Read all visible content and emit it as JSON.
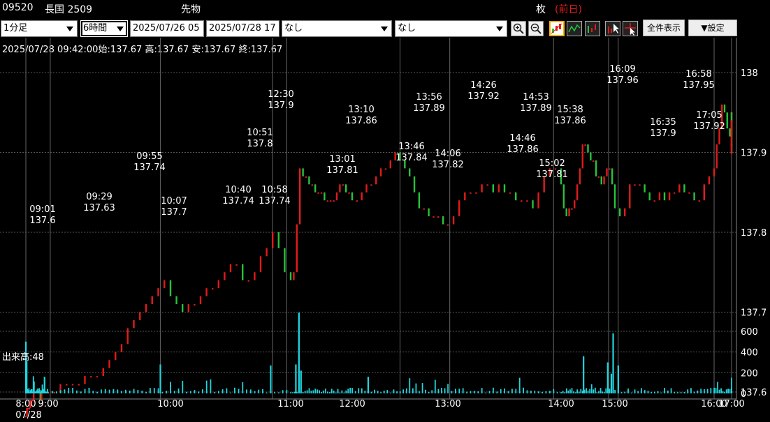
{
  "header": {
    "code": "09520",
    "name": "長国 2509",
    "category": "先物",
    "unit_label": "枚",
    "prev_label": "(前日)"
  },
  "toolbar": {
    "interval": "1分足",
    "period": "6時間",
    "date_from": "2025/07/26 05",
    "date_to": "2025/07/28 17",
    "indicator1": "なし",
    "indicator2": "なし",
    "zoom_in_icon": "zoom-in-icon",
    "zoom_out_icon": "zoom-out-icon",
    "full_view_label": "全件表示",
    "settings_label": "▼設定"
  },
  "info_line": "2025/07/28 09:42:00始:137.67 高:137.67 安:137.67 終:137.67",
  "volume_label": "出来高:48",
  "date_label": "07/28",
  "colors": {
    "up": "#e21b1b",
    "down": "#27c33c",
    "volume": "#1fd6e0",
    "grid": "#555555",
    "accent": "#e21b1b"
  },
  "chart_data": [
    {
      "type": "candlestick",
      "x_ticks": [
        "8:00",
        "9:00",
        "10:00",
        "11:00",
        "12:00",
        "13:00",
        "14:00",
        "15:00",
        "16:00",
        "17:00"
      ],
      "y_ticks": [
        137.6,
        137.7,
        137.8,
        137.9,
        138
      ],
      "ylim": [
        137.52,
        138.02
      ],
      "price_path": [
        [
          "8:00",
          137.57
        ],
        [
          "8:05",
          137.58
        ],
        [
          "8:15",
          137.59
        ],
        [
          "8:30",
          137.6
        ],
        [
          "9:01",
          137.6
        ],
        [
          "9:10",
          137.61
        ],
        [
          "9:20",
          137.62
        ],
        [
          "9:29",
          137.63
        ],
        [
          "9:40",
          137.68
        ],
        [
          "9:48",
          137.71
        ],
        [
          "9:55",
          137.74
        ],
        [
          "10:02",
          137.72
        ],
        [
          "10:07",
          137.7
        ],
        [
          "10:20",
          137.73
        ],
        [
          "10:30",
          137.76
        ],
        [
          "10:40",
          137.74
        ],
        [
          "10:45",
          137.77
        ],
        [
          "10:51",
          137.8
        ],
        [
          "10:55",
          137.77
        ],
        [
          "10:58",
          137.74
        ],
        [
          "11:00",
          137.73
        ],
        [
          "11:05",
          137.76
        ],
        [
          "11:08",
          137.9
        ],
        [
          "11:10",
          137.87
        ],
        [
          "11:30",
          137.85
        ],
        [
          "11:40",
          137.83
        ],
        [
          "11:50",
          137.86
        ],
        [
          "12:00",
          137.84
        ],
        [
          "12:30",
          137.9
        ],
        [
          "12:45",
          137.82
        ],
        [
          "13:01",
          137.81
        ],
        [
          "13:10",
          137.86
        ],
        [
          "13:30",
          137.85
        ],
        [
          "13:46",
          137.84
        ],
        [
          "13:56",
          137.89
        ],
        [
          "14:00",
          137.86
        ],
        [
          "14:06",
          137.82
        ],
        [
          "14:15",
          137.84
        ],
        [
          "14:26",
          137.92
        ],
        [
          "14:40",
          137.87
        ],
        [
          "14:46",
          137.86
        ],
        [
          "14:53",
          137.89
        ],
        [
          "15:02",
          137.81
        ],
        [
          "15:10",
          137.86
        ],
        [
          "15:25",
          137.84
        ],
        [
          "15:38",
          137.86
        ],
        [
          "15:50",
          137.84
        ],
        [
          "16:00",
          137.88
        ],
        [
          "16:09",
          137.96
        ],
        [
          "16:20",
          137.91
        ],
        [
          "16:35",
          137.9
        ],
        [
          "16:45",
          137.94
        ],
        [
          "16:58",
          137.95
        ],
        [
          "17:05",
          137.92
        ],
        [
          "17:15",
          137.94
        ]
      ],
      "annotations": [
        {
          "time": "09:01",
          "price": "137.6"
        },
        {
          "time": "09:29",
          "price": "137.63"
        },
        {
          "time": "09:55",
          "price": "137.74"
        },
        {
          "time": "10:07",
          "price": "137.7"
        },
        {
          "time": "10:40",
          "price": "137.74"
        },
        {
          "time": "10:51",
          "price": "137.8"
        },
        {
          "time": "10:58",
          "price": "137.74"
        },
        {
          "time": "12:30",
          "price": "137.9"
        },
        {
          "time": "13:01",
          "price": "137.81"
        },
        {
          "time": "13:10",
          "price": "137.86"
        },
        {
          "time": "13:46",
          "price": "137.84"
        },
        {
          "time": "13:56",
          "price": "137.89"
        },
        {
          "time": "14:06",
          "price": "137.82"
        },
        {
          "time": "14:26",
          "price": "137.92"
        },
        {
          "time": "14:46",
          "price": "137.86"
        },
        {
          "time": "14:53",
          "price": "137.89"
        },
        {
          "time": "15:02",
          "price": "137.81"
        },
        {
          "time": "15:38",
          "price": "137.86"
        },
        {
          "time": "16:09",
          "price": "137.96"
        },
        {
          "time": "16:35",
          "price": "137.9"
        },
        {
          "time": "16:58",
          "price": "137.95"
        },
        {
          "time": "17:05",
          "price": "137.92"
        }
      ]
    },
    {
      "type": "bar",
      "name": "出来高",
      "y_ticks": [
        0,
        200,
        400,
        600
      ],
      "ylim": [
        0,
        700
      ],
      "spikes": [
        [
          "8:00",
          500
        ],
        [
          "8:02",
          310
        ],
        [
          "8:50",
          160
        ],
        [
          "9:55",
          280
        ],
        [
          "10:50",
          270
        ],
        [
          "11:05",
          280
        ],
        [
          "11:08",
          780
        ],
        [
          "11:10",
          220
        ],
        [
          "12:10",
          160
        ],
        [
          "14:25",
          360
        ],
        [
          "14:52",
          300
        ],
        [
          "14:56",
          190
        ],
        [
          "14:58",
          580
        ],
        [
          "15:02",
          270
        ]
      ],
      "typical": 40,
      "grid": true
    }
  ]
}
